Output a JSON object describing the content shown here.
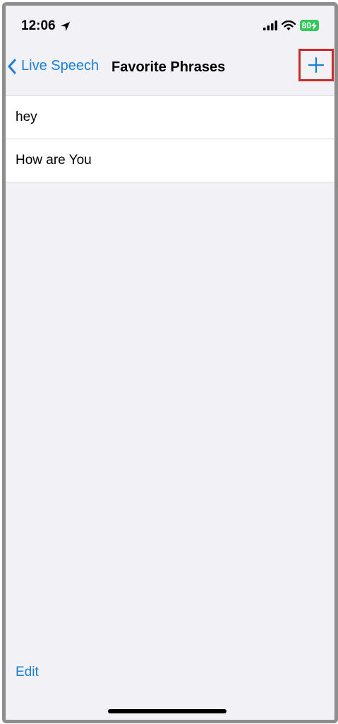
{
  "status_bar": {
    "time": "12:06",
    "battery": "80"
  },
  "nav": {
    "back_label": "Live Speech",
    "title": "Favorite Phrases",
    "add_icon": "plus-icon"
  },
  "phrases": [
    {
      "text": "hey"
    },
    {
      "text": "How are You"
    }
  ],
  "toolbar": {
    "edit_label": "Edit"
  },
  "colors": {
    "accent": "#1a7fd6",
    "highlight": "#cc2a2a",
    "battery": "#34c759",
    "background": "#f2f1f6"
  }
}
